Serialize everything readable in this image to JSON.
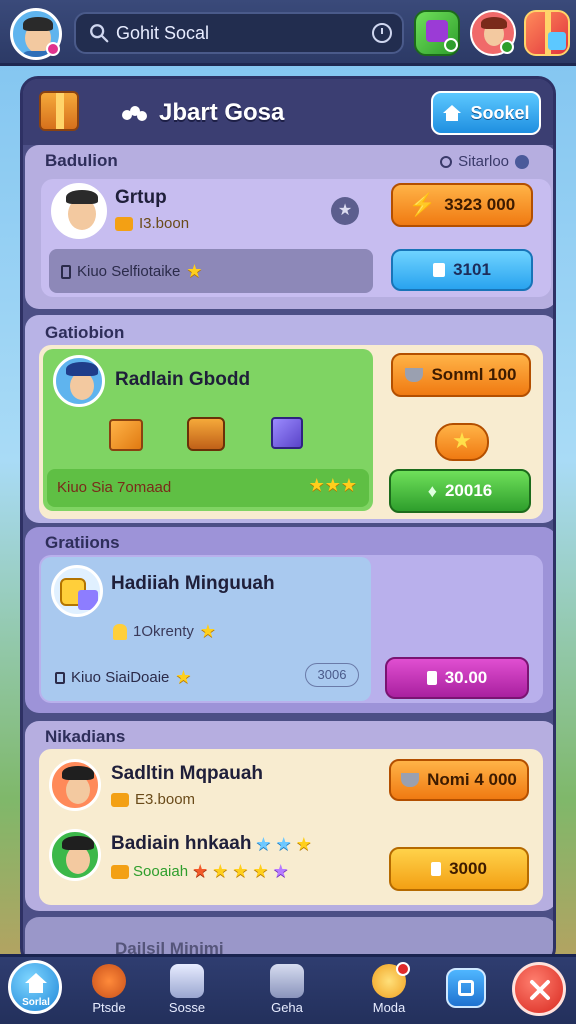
{
  "header": {
    "search_placeholder": "Gohit Socal",
    "search_value": "Gohit Socal"
  },
  "panel": {
    "title": "Jbart Gosa",
    "top_button": "Sookel"
  },
  "section1": {
    "label": "Badulion",
    "right_label": "Sitarloo",
    "name": "Grtup",
    "sub": "I3.boon",
    "row_text": "Kiuo Selfiotaike",
    "btn_top": "3323 000",
    "btn_bottom": "3101"
  },
  "section2": {
    "label": "Gatiobion",
    "name": "Radlain Gbodd",
    "row_text": "Kiuo Sia 7omaad",
    "btn_top": "Sonml 100",
    "btn_bottom": "20016"
  },
  "section3": {
    "label": "Gratiions",
    "name": "Hadiiah Minguuah",
    "sub": "1Okrenty",
    "row_text": "Kiuo SiaiDoaie",
    "badge": "3006",
    "btn": "30.00"
  },
  "section4": {
    "label": "Nikadians",
    "name1": "Sadltin Mqpauah",
    "sub1": "E3.boom",
    "name2": "Badiain hnkaah",
    "sub2": "Sooaiah",
    "btn1": "Nomi 4 000",
    "btn2": "3000"
  },
  "footer_peek": "Dailsil Minimi",
  "nav": {
    "home": "Sorlal",
    "items": [
      "Ptsde",
      "Sosse",
      "Geha",
      "Moda"
    ]
  },
  "colors": {
    "accent_orange": "#f07a12",
    "accent_blue": "#29a3ef",
    "accent_green": "#2e9e2c",
    "accent_magenta": "#a9209f",
    "panel_bg": "#4c4f86"
  },
  "icons": {
    "search": "search-icon",
    "clock": "clock-icon",
    "home": "home-icon",
    "close": "close-icon"
  }
}
